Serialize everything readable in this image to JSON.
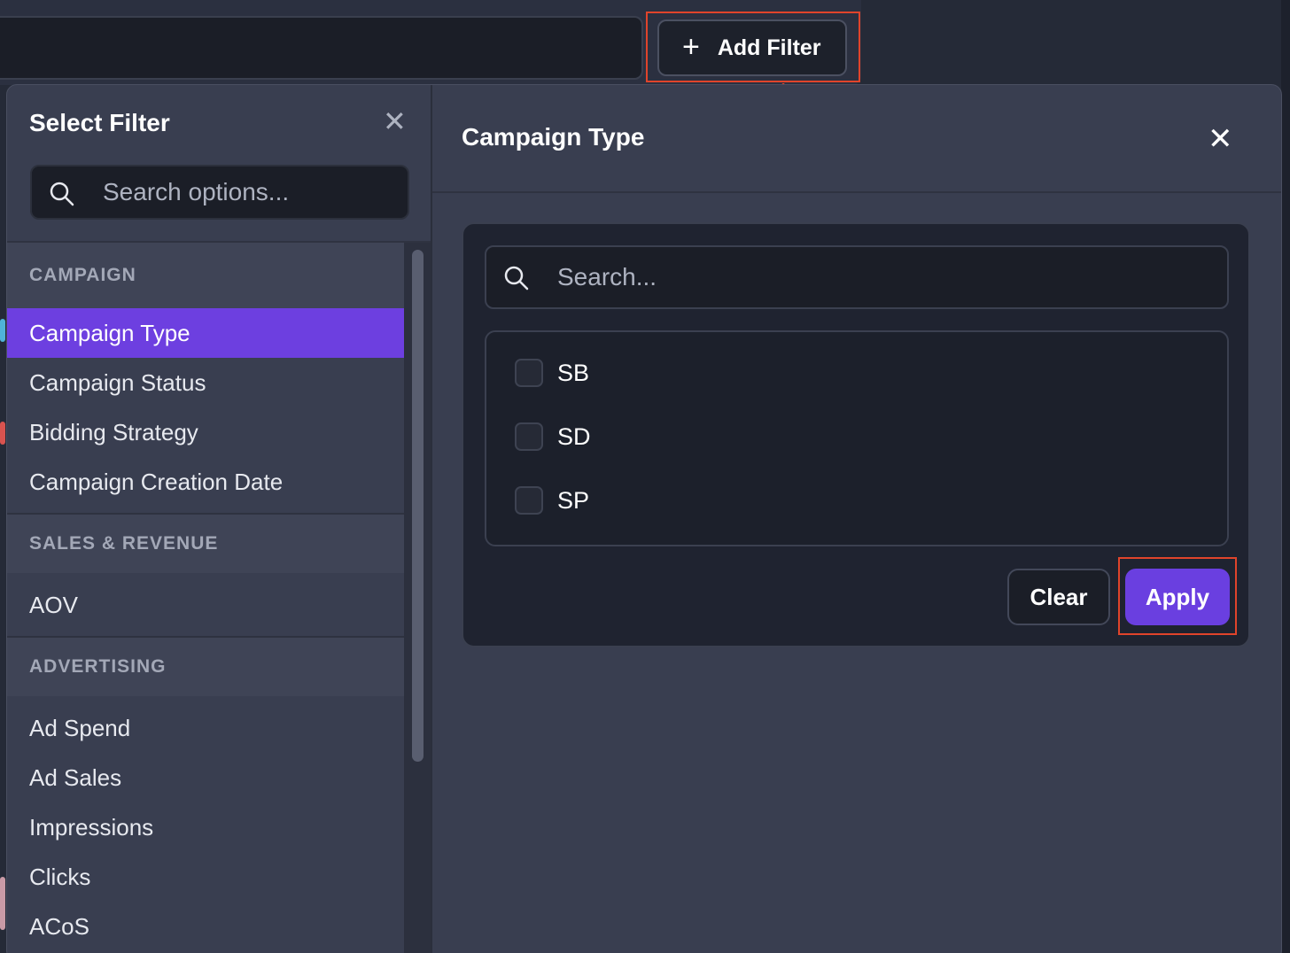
{
  "toolbar": {
    "add_filter_label": "Add Filter",
    "plus_glyph": "+"
  },
  "select_filter": {
    "title": "Select Filter",
    "close_glyph": "✕",
    "search_placeholder": "Search options...",
    "groups": [
      {
        "label": "CAMPAIGN",
        "items": [
          "Campaign Type",
          "Campaign Status",
          "Bidding Strategy",
          "Campaign Creation Date"
        ],
        "active_item": "Campaign Type"
      },
      {
        "label": "SALES & REVENUE",
        "items": [
          "AOV"
        ]
      },
      {
        "label": "ADVERTISING",
        "items": [
          "Ad Spend",
          "Ad Sales",
          "Impressions",
          "Clicks",
          "ACoS"
        ]
      }
    ]
  },
  "campaign_type": {
    "title": "Campaign Type",
    "close_glyph": "✕",
    "search_placeholder": "Search...",
    "options": [
      "SB",
      "SD",
      "SP"
    ],
    "clear_label": "Clear",
    "apply_label": "Apply"
  },
  "colors": {
    "accent": "#6d3fe0",
    "highlight": "#e0442b",
    "panel_bg": "#393e50",
    "dark_field": "#1b1e27"
  },
  "icons": {
    "search": "search-icon",
    "close": "close-icon",
    "plus": "plus-icon"
  }
}
